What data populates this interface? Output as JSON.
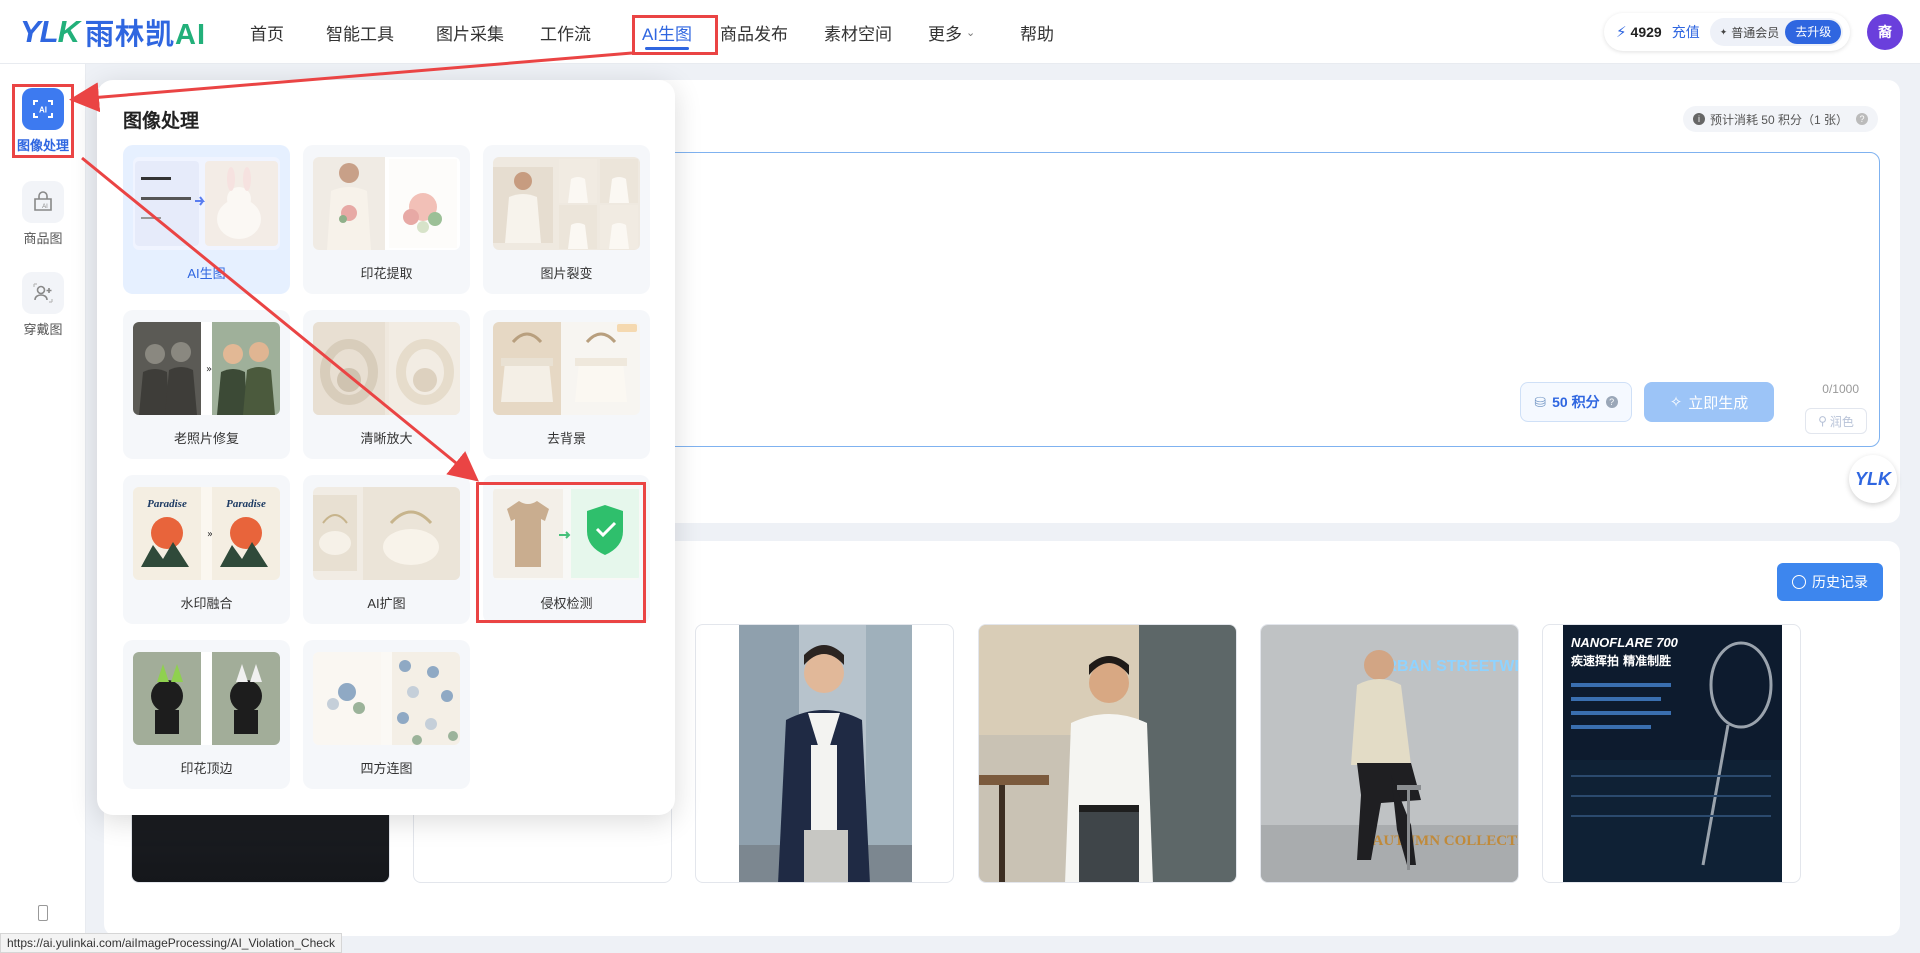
{
  "app": {
    "logo_mark": "YL",
    "logo_mark_k": "K",
    "logo_text": "雨林凯",
    "logo_text_ai": "AI"
  },
  "nav": {
    "items": [
      "首页",
      "智能工具",
      "图片采集",
      "工作流",
      "AI生图",
      "商品发布",
      "素材空间",
      "更多",
      "帮助"
    ],
    "active_index": 4
  },
  "account": {
    "credits": "4929",
    "recharge": "充值",
    "member": "普通会员",
    "upgrade": "去升级",
    "avatar": "裔"
  },
  "sidebar": {
    "items": [
      {
        "label": "图像处理",
        "icon": "ai-image-icon",
        "active": true
      },
      {
        "label": "商品图",
        "icon": "shop-ai-icon",
        "active": false
      },
      {
        "label": "穿戴图",
        "icon": "person-add-icon",
        "active": false
      }
    ]
  },
  "main": {
    "cost_hint": "预计消耗 50 积分（1 张）",
    "counter": "0/1000",
    "polish": "润色",
    "cost_button": "50 积分",
    "generate_button": "立即生成",
    "float_logo": "YLK"
  },
  "gallery": {
    "history_button": "历史记录",
    "thumbs": [
      {
        "name": "dark-product-thumb"
      },
      {
        "name": "blank-thumb"
      },
      {
        "name": "man-navy-blazer-thumb"
      },
      {
        "name": "man-white-shirt-thumb"
      },
      {
        "name": "urban-streetwear-thumb",
        "sign_text": "URBAN STREETWEAR",
        "caption": "AUTUMN COLLECTION"
      },
      {
        "name": "nanoflare-racket-thumb",
        "brand": "NANOFLARE 700",
        "slogan": "疾速挥拍 精准制胜"
      }
    ]
  },
  "dropdown": {
    "title": "图像处理",
    "tools": [
      {
        "label": "AI生图",
        "active": true
      },
      {
        "label": "印花提取",
        "active": false
      },
      {
        "label": "图片裂变",
        "active": false
      },
      {
        "label": "老照片修复",
        "active": false
      },
      {
        "label": "清晰放大",
        "active": false
      },
      {
        "label": "去背景",
        "active": false
      },
      {
        "label": "水印融合",
        "active": false
      },
      {
        "label": "AI扩图",
        "active": false
      },
      {
        "label": "侵权检测",
        "active": false
      },
      {
        "label": "印花顶边",
        "active": false
      },
      {
        "label": "四方连图",
        "active": false
      }
    ]
  },
  "statusbar": {
    "url": "https://ai.yulinkai.com/aiImageProcessing/AI_Violation_Check"
  },
  "colors": {
    "brand_blue": "#2f66e0",
    "brand_green": "#22b07a",
    "annotation_red": "#ea4444"
  }
}
